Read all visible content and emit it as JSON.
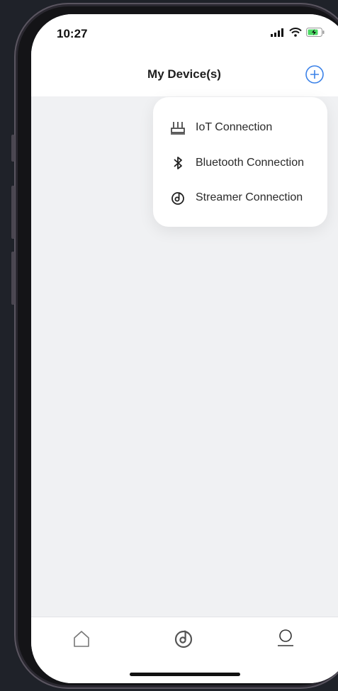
{
  "status": {
    "time": "10:27"
  },
  "header": {
    "title": "My Device(s)"
  },
  "menu": {
    "items": [
      {
        "label": "IoT Connection",
        "icon": "router-icon"
      },
      {
        "label": "Bluetooth Connection",
        "icon": "bluetooth-icon"
      },
      {
        "label": "Streamer Connection",
        "icon": "streamer-icon"
      }
    ]
  },
  "tabs": [
    {
      "name": "home",
      "icon": "home-icon"
    },
    {
      "name": "music",
      "icon": "music-icon"
    },
    {
      "name": "profile",
      "icon": "user-icon"
    }
  ],
  "colors": {
    "accent": "#3b82e8",
    "background": "#f0f1f3"
  }
}
